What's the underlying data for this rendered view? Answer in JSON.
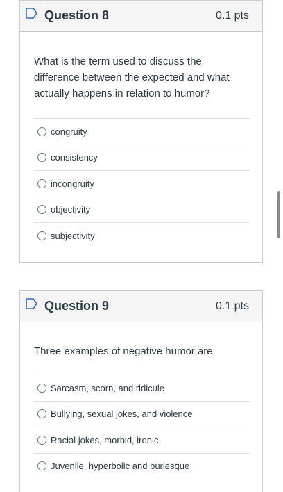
{
  "questions": [
    {
      "title": "Question 8",
      "points": "0.1 pts",
      "text": "What is the term used to discuss the difference between the expected and what actually happens in relation to humor?",
      "options": [
        "congruity",
        "consistency",
        "incongruity",
        "objectivity",
        "subjectivity"
      ]
    },
    {
      "title": "Question 9",
      "points": "0.1 pts",
      "text": "Three examples of negative humor are",
      "options": [
        "Sarcasm, scorn, and ridicule",
        "Bullying, sexual jokes, and violence",
        "Racial jokes, morbid, ironic",
        "Juvenile, hyperbolic and burlesque"
      ]
    }
  ],
  "icons": {
    "flag": "flag-question-icon",
    "radio": "radio-button-icon"
  },
  "colors": {
    "header_bg": "#f5f5f5",
    "border": "#c7cdd1",
    "text": "#2d3b45",
    "flag": "#2d6fbb"
  }
}
